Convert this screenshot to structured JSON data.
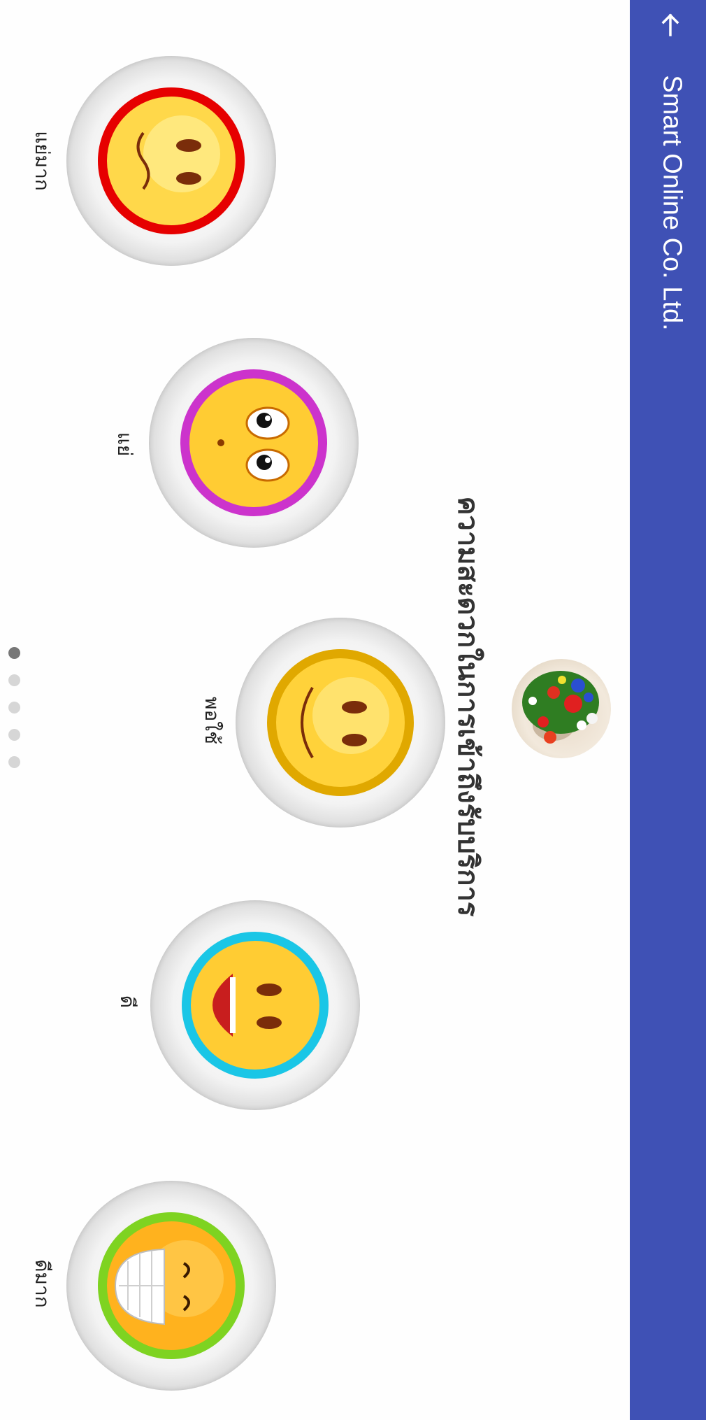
{
  "app_bar": {
    "title": "Smart Online Co. Ltd.",
    "background": "#3f51b5",
    "back_icon": "arrow-back-icon"
  },
  "survey": {
    "question": "ความสะดวกในการเข้าถึงรับบริการ",
    "logo_icon": "flower-bouquet-logo"
  },
  "ratings": [
    {
      "label": "แย่มาก",
      "ring_color": "#e60000",
      "expression": "frown"
    },
    {
      "label": "แย่",
      "ring_color": "#cc33cc",
      "expression": "surprised"
    },
    {
      "label": "พอใช้",
      "ring_color": "#e0a800",
      "expression": "smile"
    },
    {
      "label": "ดี",
      "ring_color": "#1ac6e6",
      "expression": "laugh"
    },
    {
      "label": "ดีมาก",
      "ring_color": "#7ed321",
      "expression": "grin"
    }
  ],
  "pagination": {
    "pages": 5,
    "current": 1
  }
}
